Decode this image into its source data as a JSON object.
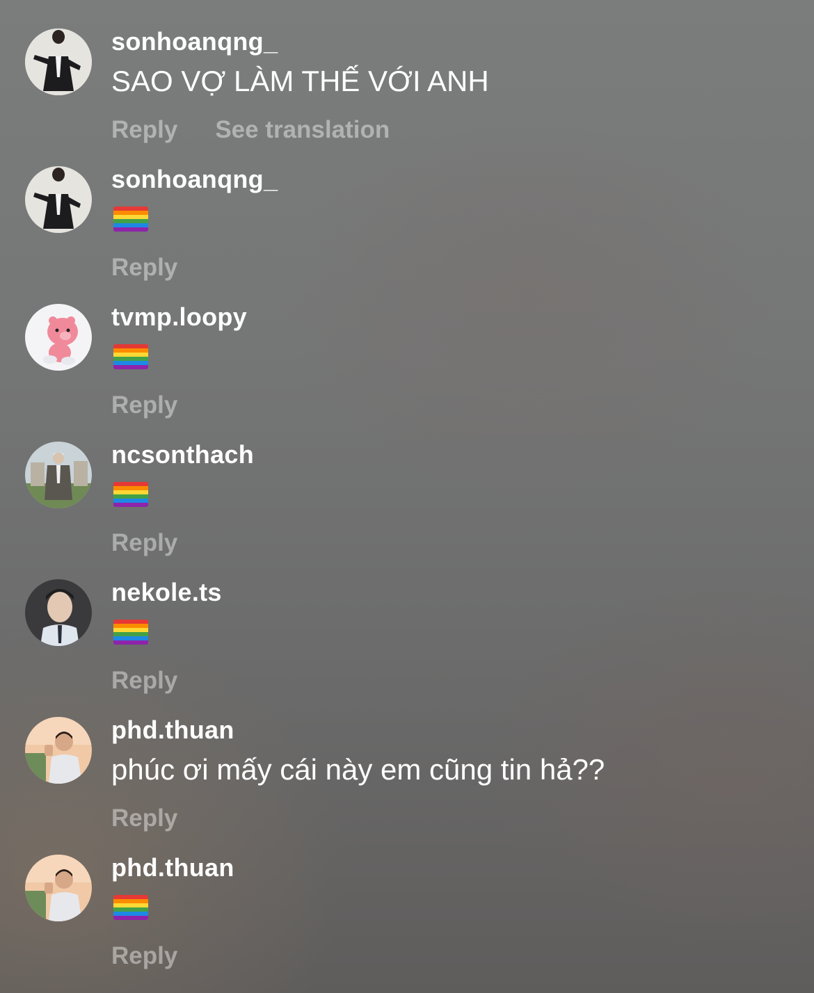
{
  "comments": [
    {
      "username": "sonhoanqng_",
      "text": "SAO VỢ LÀM THẾ VỚI ANH",
      "reply_label": "Reply",
      "translate_label": "See translation"
    },
    {
      "username": "sonhoanqng_",
      "emoji": "rainbow-flag",
      "reply_label": "Reply"
    },
    {
      "username": "tvmp.loopy",
      "emoji": "rainbow-flag",
      "reply_label": "Reply"
    },
    {
      "username": "ncsonthach",
      "emoji": "rainbow-flag",
      "reply_label": "Reply"
    },
    {
      "username": "nekole.ts",
      "emoji": "rainbow-flag",
      "reply_label": "Reply"
    },
    {
      "username": "phd.thuan",
      "text": "phúc ơi mấy cái này em cũng tin hả??",
      "reply_label": "Reply"
    },
    {
      "username": "phd.thuan",
      "emoji": "rainbow-flag",
      "reply_label": "Reply"
    }
  ],
  "colors": {
    "username": "#ffffff",
    "comment_text": "#ffffff",
    "action_text": "rgba(255,255,255,0.42)"
  }
}
